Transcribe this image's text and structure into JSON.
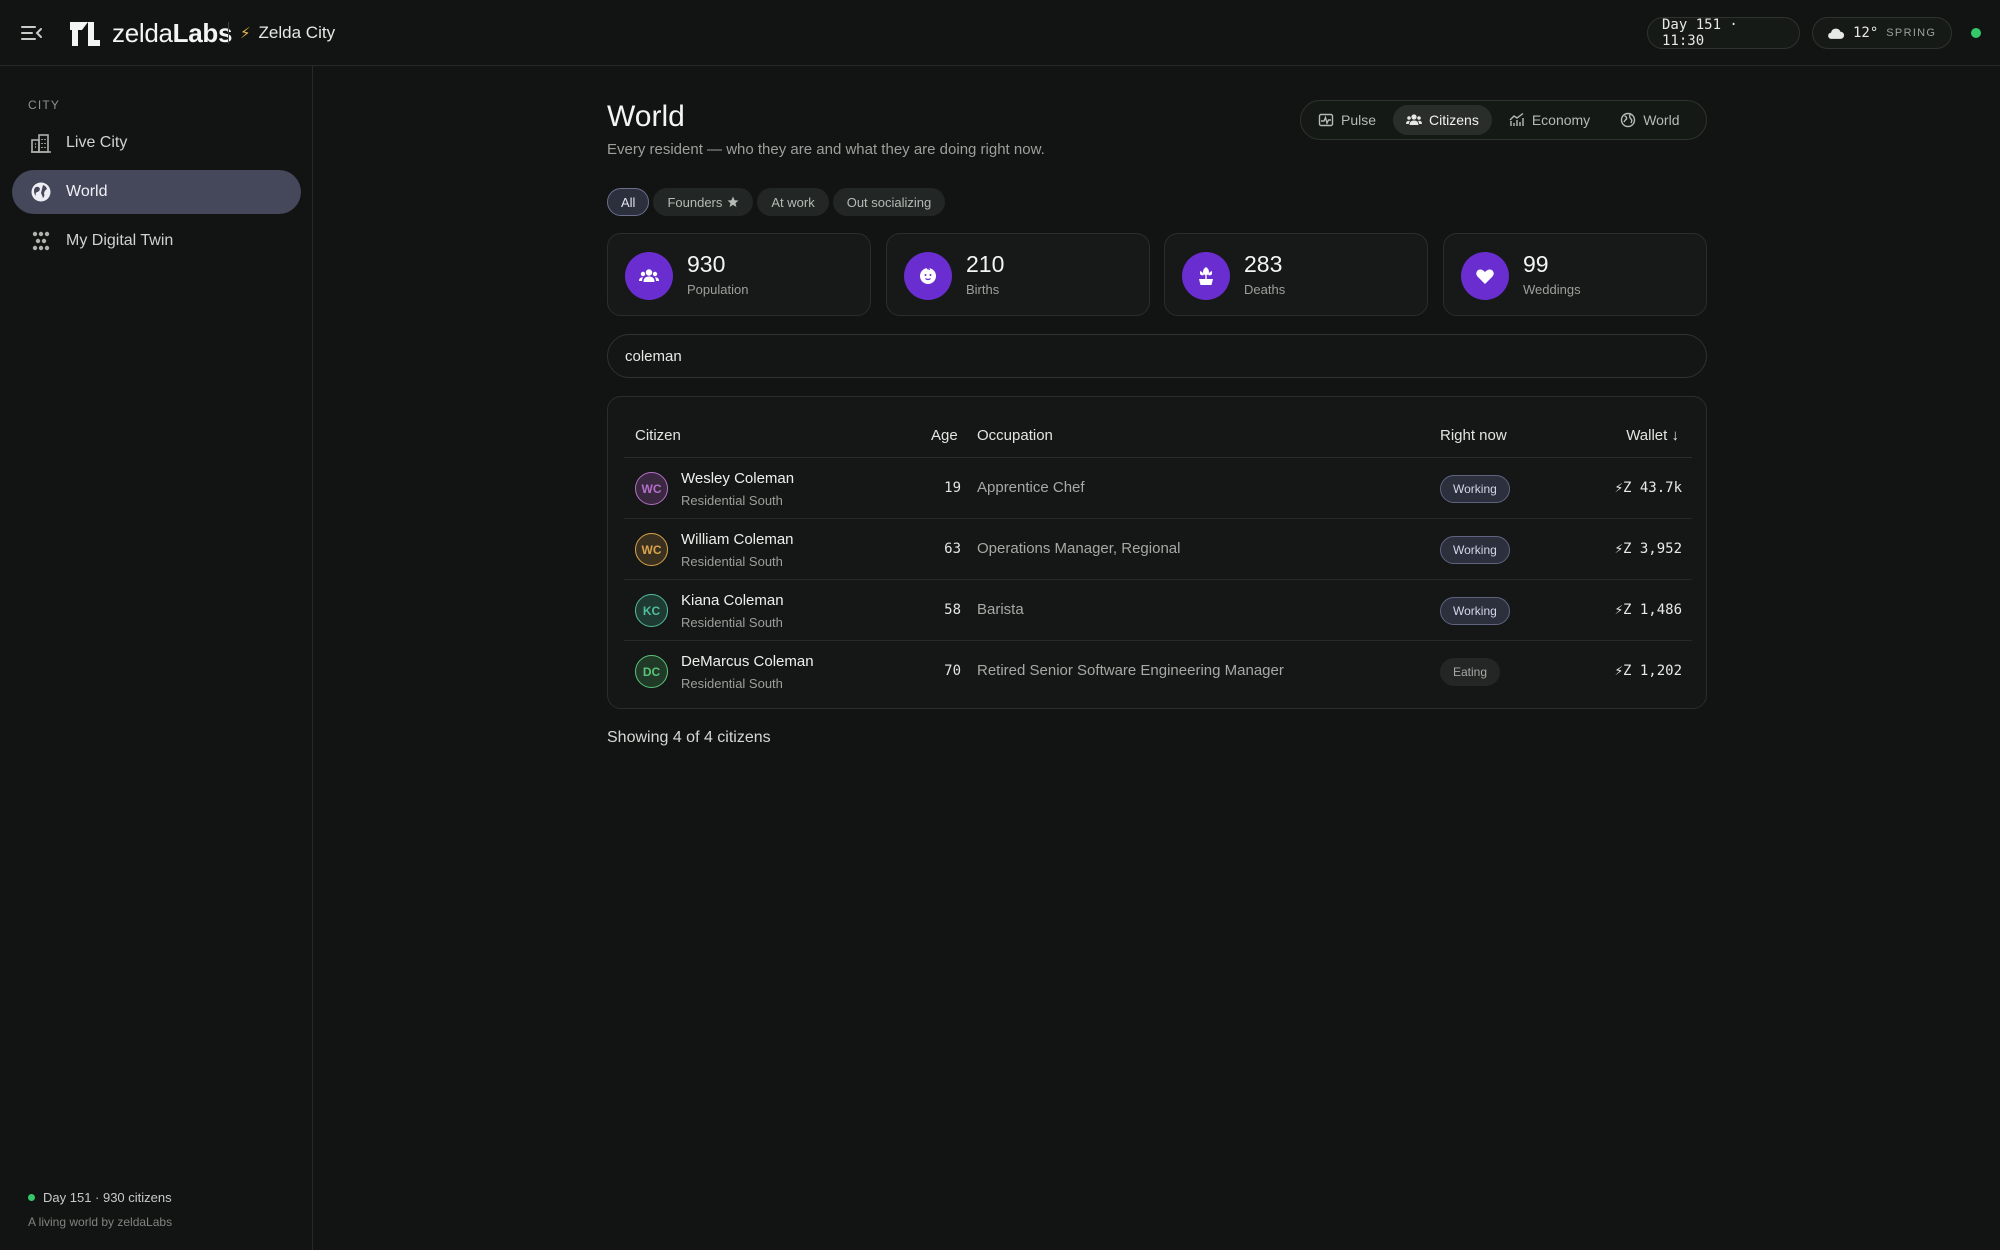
{
  "header": {
    "brand_prefix": "zelda",
    "brand_suffix": "Labs",
    "city": "Zelda City",
    "day_time": "Day 151 · 11:30",
    "temperature": "12°",
    "season": "SPRING",
    "status_color": "#35c86a"
  },
  "sidebar": {
    "section": "CITY",
    "items": [
      {
        "label": "Live City",
        "icon": "buildings-icon"
      },
      {
        "label": "World",
        "icon": "globe-icon",
        "active": true
      },
      {
        "label": "My Digital Twin",
        "icon": "network-icon"
      }
    ],
    "footer_status": "Day 151 · 930 citizens",
    "footer_tagline": "A living world by zeldaLabs"
  },
  "main": {
    "title": "World",
    "subtitle": "Every resident — who they are and what they are doing right now.",
    "tabs": [
      {
        "label": "Pulse",
        "icon": "pulse-icon"
      },
      {
        "label": "Citizens",
        "icon": "people-icon",
        "active": true
      },
      {
        "label": "Economy",
        "icon": "chart-icon"
      },
      {
        "label": "World",
        "icon": "globe-icon"
      }
    ],
    "filters": [
      {
        "label": "All",
        "active": true
      },
      {
        "label": "Founders",
        "icon": "star-icon"
      },
      {
        "label": "At work"
      },
      {
        "label": "Out socializing"
      }
    ],
    "stats": [
      {
        "value": "930",
        "label": "Population",
        "icon": "people-icon"
      },
      {
        "value": "210",
        "label": "Births",
        "icon": "baby-icon"
      },
      {
        "value": "283",
        "label": "Deaths",
        "icon": "flower-icon"
      },
      {
        "value": "99",
        "label": "Weddings",
        "icon": "heart-icon"
      }
    ],
    "accent_color": "#6a2ed0",
    "search_value": "coleman",
    "table": {
      "columns": {
        "citizen": "Citizen",
        "age": "Age",
        "occupation": "Occupation",
        "right_now": "Right now",
        "wallet": "Wallet ↓"
      },
      "rows": [
        {
          "initials": "WC",
          "name": "Wesley Coleman",
          "area": "Residential South",
          "age": "19",
          "occupation": "Apprentice Chef",
          "status": "Working",
          "wallet": "⚡Z 43.7k",
          "avatar_color": "#b46fc8",
          "avatar_bg": "#3a2740"
        },
        {
          "initials": "WC",
          "name": "William Coleman",
          "area": "Residential South",
          "age": "63",
          "occupation": "Operations Manager, Regional",
          "status": "Working",
          "wallet": "⚡Z 3,952",
          "avatar_color": "#d9a44a",
          "avatar_bg": "#3a3020"
        },
        {
          "initials": "KC",
          "name": "Kiana Coleman",
          "area": "Residential South",
          "age": "58",
          "occupation": "Barista",
          "status": "Working",
          "wallet": "⚡Z 1,486",
          "avatar_color": "#4fbf9a",
          "avatar_bg": "#1f3a32"
        },
        {
          "initials": "DC",
          "name": "DeMarcus Coleman",
          "area": "Residential South",
          "age": "70",
          "occupation": "Retired Senior Software Engineering Manager",
          "status": "Eating",
          "wallet": "⚡Z 1,202",
          "avatar_color": "#5bc47a",
          "avatar_bg": "#203a27"
        }
      ]
    },
    "showing": "Showing 4 of 4 citizens"
  }
}
